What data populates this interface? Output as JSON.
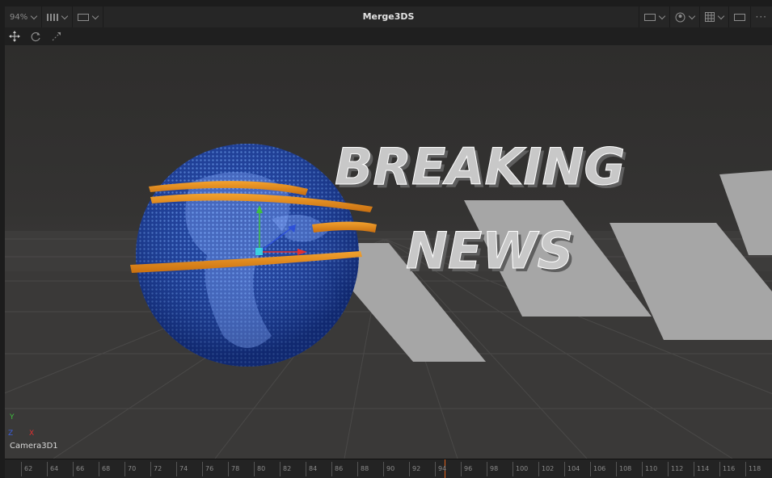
{
  "toolbar": {
    "zoom": "94%",
    "title": "Merge3DS"
  },
  "viewport": {
    "headline_line1": "BREAKING",
    "headline_line2": "NEWS",
    "camera_label": "Camera3D1",
    "axis_y": "Y",
    "axis_z": "Z",
    "axis_x": "X"
  },
  "timeline": {
    "ticks": [
      "62",
      "64",
      "66",
      "68",
      "70",
      "72",
      "74",
      "76",
      "78",
      "80",
      "82",
      "84",
      "86",
      "88",
      "90",
      "92",
      "94",
      "96",
      "98",
      "100",
      "102",
      "104",
      "106",
      "108",
      "110",
      "112",
      "114",
      "116",
      "118"
    ],
    "playhead_frame": "94"
  }
}
